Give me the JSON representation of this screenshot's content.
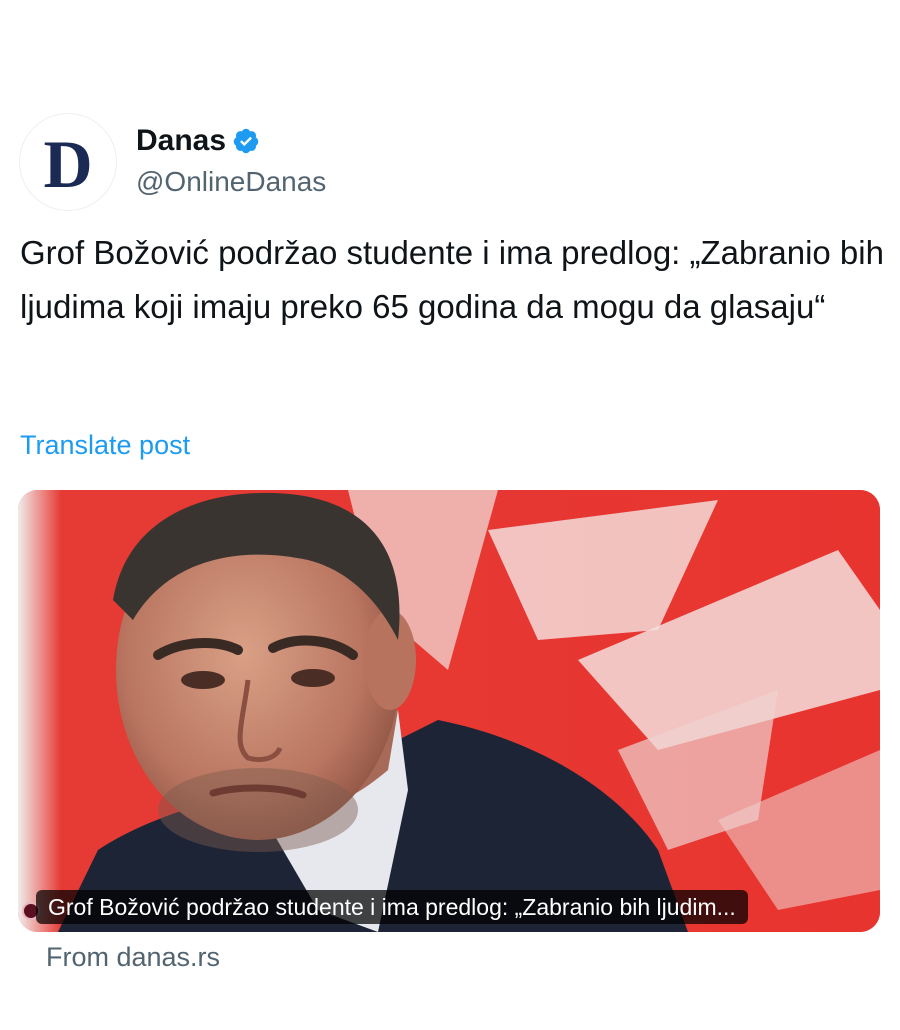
{
  "author": {
    "avatar_letter": "D",
    "display_name": "Danas",
    "handle": "@OnlineDanas",
    "verified_icon": "verified-badge-icon",
    "verified_color": "#1d9bf0"
  },
  "post": {
    "text": "Grof Božović podržao studente i ima predlog: „Zabranio bih ljudima koji imaju preko 65 godina da mogu da glasaju“",
    "translate_label": "Translate post"
  },
  "card": {
    "caption": "Grof Božović podržao studente i ima predlog: „Zabranio bih ljudim...",
    "source": "From danas.rs"
  },
  "colors": {
    "link": "#1d9bf0",
    "secondary_text": "#536471",
    "primary_text": "#0f1419",
    "card_background": "#e42f2f"
  }
}
